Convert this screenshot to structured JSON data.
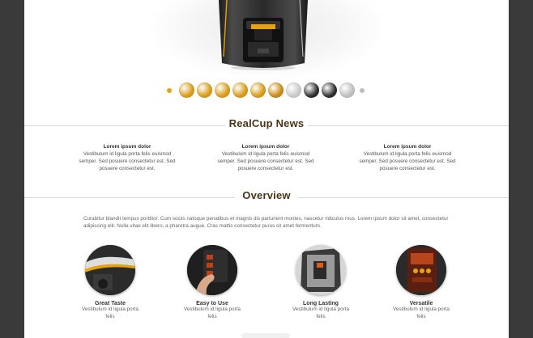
{
  "carousel": {
    "swatch_colors": [
      "#d99a12",
      "#d99a12",
      "#d99a12",
      "#d99a12",
      "#d99a12",
      "#c98a10",
      "#c9c9c9",
      "#2d2d2d",
      "#2d2d2d",
      "#bdbdbd"
    ],
    "active_dot_color": "#e8a20c"
  },
  "news": {
    "title": "RealCup News",
    "items": [
      {
        "heading": "Lorem ipsum dolor",
        "body": "Vestibulum id ligula porta felis euismod semper. Sed posuere consectetur est. Sed posuere consectetur est."
      },
      {
        "heading": "Lorem ipsum dolor",
        "body": "Vestibulum id ligula porta felis euismod semper. Sed posuere consectetur est. Sed posuere consectetur est."
      },
      {
        "heading": "Lorem ipsum dolor",
        "body": "Vestibulum id ligula porta felis euismod semper. Sed posuere consectetur est. Sed posuere consectetur est."
      }
    ]
  },
  "overview": {
    "title": "Overview",
    "text": "Curabitur blandit tempus porttitor. Cum sociis natoque penatibus et magnis dis parturient montes, nascetur ridiculus mus. Lorem ipsum dolor sit amet, consectetur adipiscing elit. Nulla vitae elit libero, a pharetra augue. Cras mattis consectetur purus sit amet fermentum.",
    "features": [
      {
        "name": "Great Taste",
        "desc": "Vestibulum id ligula porta felis"
      },
      {
        "name": "Easy to Use",
        "desc": "Vestibulum id ligula porta felis"
      },
      {
        "name": "Long Lasting",
        "desc": "Vestibulum id ligula porta felis"
      },
      {
        "name": "Versatile",
        "desc": "Vestibulum id ligula porta felis"
      }
    ]
  },
  "colors": {
    "accent": "#e8a20c",
    "heading": "#4a3415",
    "frame": "#3a3a3a"
  }
}
